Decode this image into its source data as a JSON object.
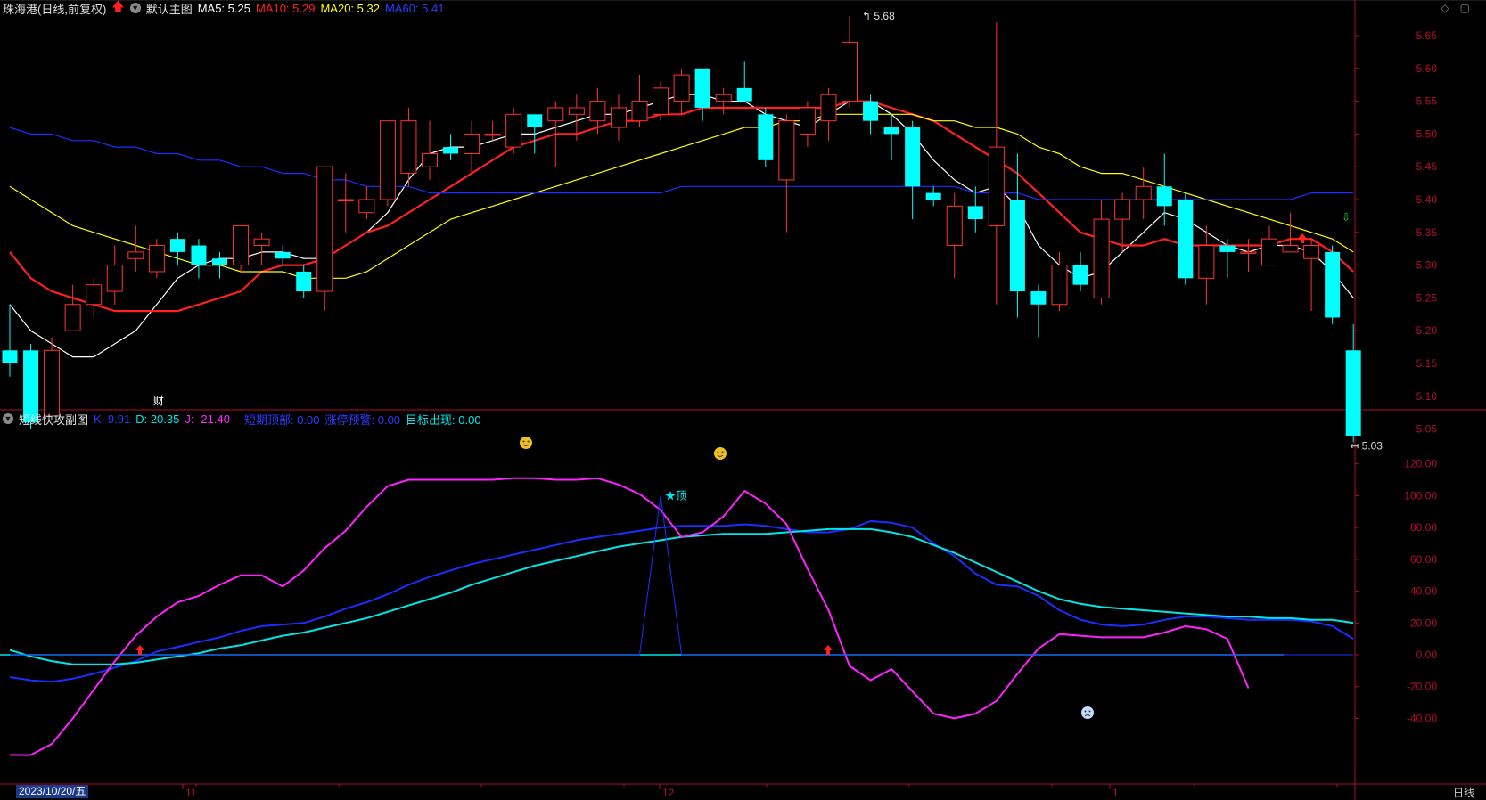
{
  "main_legend": {
    "stock": "珠海港(日线,前复权)",
    "chart_name": "默认主图",
    "ma5": "MA5: 5.25",
    "ma10": "MA10: 5.29",
    "ma20": "MA20: 5.32",
    "ma60": "MA60: 5.41"
  },
  "sub_legend": {
    "name": "短线快攻副图",
    "k": "K: 9.91",
    "d": "D: 20.35",
    "j": "J: -21.40",
    "s1": "短期顶部: 0.00",
    "s2": "涨停预警: 0.00",
    "s3": "目标出现: 0.00"
  },
  "colors": {
    "up": "#ff3232",
    "down": "#00ffff",
    "ma5": "#ffffff",
    "ma10": "#ff2020",
    "ma20": "#ffff00",
    "ma60": "#1a2fff",
    "k": "#1a2fff",
    "d": "#00e6e6",
    "j": "#ff22ff",
    "axis": "#b0102a"
  },
  "annotations": {
    "high": "5.68",
    "low": "5.03",
    "cai": "财",
    "top": "★顶"
  },
  "x_labels": [
    "11",
    "12",
    "1"
  ],
  "date_label": "2023/10/20/五",
  "period_label": "日线",
  "chart_data": [
    {
      "type": "candlestick",
      "y_ticks": [
        "5.65",
        "5.60",
        "5.55",
        "5.50",
        "5.45",
        "5.40",
        "5.35",
        "5.30",
        "5.25",
        "5.20",
        "5.15",
        "5.10",
        "5.05"
      ],
      "ylim": [
        5.0,
        5.71
      ],
      "candles": [
        [
          5.17,
          5.15,
          5.24,
          5.13
        ],
        [
          5.17,
          5.06,
          5.18,
          5.05
        ],
        [
          5.07,
          5.17,
          5.19,
          5.07
        ],
        [
          5.2,
          5.24,
          5.27,
          5.2
        ],
        [
          5.24,
          5.27,
          5.28,
          5.22
        ],
        [
          5.26,
          5.3,
          5.33,
          5.24
        ],
        [
          5.31,
          5.32,
          5.36,
          5.29
        ],
        [
          5.29,
          5.33,
          5.34,
          5.28
        ],
        [
          5.34,
          5.32,
          5.35,
          5.3
        ],
        [
          5.33,
          5.3,
          5.34,
          5.28
        ],
        [
          5.31,
          5.3,
          5.32,
          5.28
        ],
        [
          5.3,
          5.36,
          5.36,
          5.29
        ],
        [
          5.33,
          5.34,
          5.35,
          5.3
        ],
        [
          5.32,
          5.31,
          5.33,
          5.3
        ],
        [
          5.29,
          5.26,
          5.3,
          5.25
        ],
        [
          5.26,
          5.45,
          5.45,
          5.23
        ],
        [
          5.4,
          5.4,
          5.44,
          5.35
        ],
        [
          5.38,
          5.4,
          5.42,
          5.37
        ],
        [
          5.4,
          5.52,
          5.52,
          5.39
        ],
        [
          5.44,
          5.52,
          5.54,
          5.42
        ],
        [
          5.45,
          5.47,
          5.52,
          5.43
        ],
        [
          5.48,
          5.47,
          5.5,
          5.46
        ],
        [
          5.47,
          5.5,
          5.52,
          5.44
        ],
        [
          5.5,
          5.5,
          5.52,
          5.49
        ],
        [
          5.48,
          5.53,
          5.54,
          5.47
        ],
        [
          5.53,
          5.51,
          5.53,
          5.47
        ],
        [
          5.52,
          5.54,
          5.55,
          5.45
        ],
        [
          5.53,
          5.54,
          5.56,
          5.49
        ],
        [
          5.52,
          5.55,
          5.57,
          5.5
        ],
        [
          5.51,
          5.54,
          5.56,
          5.49
        ],
        [
          5.52,
          5.55,
          5.59,
          5.51
        ],
        [
          5.53,
          5.57,
          5.58,
          5.52
        ],
        [
          5.55,
          5.59,
          5.6,
          5.53
        ],
        [
          5.6,
          5.54,
          5.6,
          5.52
        ],
        [
          5.55,
          5.56,
          5.57,
          5.53
        ],
        [
          5.57,
          5.55,
          5.61,
          5.55
        ],
        [
          5.53,
          5.46,
          5.54,
          5.45
        ],
        [
          5.43,
          5.52,
          5.53,
          5.35
        ],
        [
          5.5,
          5.54,
          5.55,
          5.48
        ],
        [
          5.52,
          5.56,
          5.57,
          5.49
        ],
        [
          5.55,
          5.64,
          5.68,
          5.54
        ],
        [
          5.55,
          5.52,
          5.56,
          5.5
        ],
        [
          5.51,
          5.5,
          5.53,
          5.46
        ],
        [
          5.51,
          5.42,
          5.52,
          5.37
        ],
        [
          5.41,
          5.4,
          5.42,
          5.39
        ],
        [
          5.33,
          5.39,
          5.41,
          5.28
        ],
        [
          5.39,
          5.37,
          5.42,
          5.35
        ],
        [
          5.36,
          5.48,
          5.67,
          5.24
        ],
        [
          5.4,
          5.26,
          5.47,
          5.22
        ],
        [
          5.26,
          5.24,
          5.27,
          5.19
        ],
        [
          5.24,
          5.3,
          5.32,
          5.23
        ],
        [
          5.3,
          5.27,
          5.32,
          5.26
        ],
        [
          5.25,
          5.37,
          5.4,
          5.24
        ],
        [
          5.37,
          5.4,
          5.41,
          5.32
        ],
        [
          5.4,
          5.42,
          5.45,
          5.37
        ],
        [
          5.42,
          5.39,
          5.47,
          5.36
        ],
        [
          5.4,
          5.28,
          5.41,
          5.27
        ],
        [
          5.28,
          5.33,
          5.36,
          5.24
        ],
        [
          5.33,
          5.32,
          5.34,
          5.28
        ],
        [
          5.32,
          5.32,
          5.34,
          5.29
        ],
        [
          5.3,
          5.34,
          5.36,
          5.3
        ],
        [
          5.32,
          5.33,
          5.38,
          5.32
        ],
        [
          5.31,
          5.33,
          5.34,
          5.23
        ],
        [
          5.32,
          5.22,
          5.33,
          5.21
        ],
        [
          5.17,
          5.04,
          5.21,
          5.03
        ]
      ],
      "series": [
        {
          "name": "MA5",
          "values": [
            5.24,
            5.2,
            5.18,
            5.16,
            5.16,
            5.18,
            5.2,
            5.24,
            5.28,
            5.3,
            5.31,
            5.31,
            5.32,
            5.32,
            5.31,
            5.31,
            5.33,
            5.35,
            5.38,
            5.43,
            5.47,
            5.48,
            5.48,
            5.49,
            5.5,
            5.5,
            5.51,
            5.52,
            5.53,
            5.53,
            5.54,
            5.55,
            5.56,
            5.56,
            5.55,
            5.55,
            5.53,
            5.52,
            5.51,
            5.53,
            5.55,
            5.55,
            5.53,
            5.5,
            5.46,
            5.43,
            5.41,
            5.42,
            5.39,
            5.33,
            5.3,
            5.28,
            5.29,
            5.32,
            5.35,
            5.38,
            5.37,
            5.35,
            5.33,
            5.32,
            5.33,
            5.33,
            5.32,
            5.29,
            5.25
          ]
        },
        {
          "name": "MA10",
          "values": [
            5.32,
            5.28,
            5.26,
            5.25,
            5.24,
            5.23,
            5.23,
            5.23,
            5.23,
            5.24,
            5.25,
            5.26,
            5.29,
            5.3,
            5.3,
            5.31,
            5.33,
            5.35,
            5.36,
            5.38,
            5.4,
            5.42,
            5.44,
            5.46,
            5.48,
            5.49,
            5.5,
            5.5,
            5.51,
            5.52,
            5.52,
            5.53,
            5.53,
            5.54,
            5.54,
            5.54,
            5.54,
            5.54,
            5.54,
            5.54,
            5.55,
            5.55,
            5.54,
            5.53,
            5.52,
            5.5,
            5.48,
            5.46,
            5.44,
            5.41,
            5.38,
            5.35,
            5.34,
            5.33,
            5.33,
            5.34,
            5.33,
            5.33,
            5.33,
            5.33,
            5.33,
            5.34,
            5.34,
            5.32,
            5.29
          ]
        },
        {
          "name": "MA20",
          "values": [
            5.42,
            5.4,
            5.38,
            5.36,
            5.35,
            5.34,
            5.33,
            5.32,
            5.31,
            5.3,
            5.3,
            5.29,
            5.29,
            5.29,
            5.28,
            5.28,
            5.28,
            5.29,
            5.31,
            5.33,
            5.35,
            5.37,
            5.38,
            5.39,
            5.4,
            5.41,
            5.42,
            5.43,
            5.44,
            5.45,
            5.46,
            5.47,
            5.48,
            5.49,
            5.5,
            5.51,
            5.51,
            5.52,
            5.52,
            5.53,
            5.53,
            5.53,
            5.53,
            5.53,
            5.52,
            5.52,
            5.51,
            5.51,
            5.5,
            5.48,
            5.47,
            5.45,
            5.44,
            5.44,
            5.43,
            5.42,
            5.41,
            5.4,
            5.39,
            5.38,
            5.37,
            5.36,
            5.35,
            5.34,
            5.32
          ]
        },
        {
          "name": "MA60",
          "values": [
            5.51,
            5.5,
            5.5,
            5.49,
            5.49,
            5.48,
            5.48,
            5.47,
            5.47,
            5.46,
            5.46,
            5.45,
            5.45,
            5.44,
            5.44,
            5.43,
            5.43,
            5.42,
            5.42,
            5.42,
            5.41,
            5.41,
            5.41,
            5.41,
            5.41,
            5.41,
            5.41,
            5.41,
            5.41,
            5.41,
            5.41,
            5.41,
            5.42,
            5.42,
            5.42,
            5.42,
            5.42,
            5.42,
            5.42,
            5.42,
            5.42,
            5.42,
            5.42,
            5.42,
            5.42,
            5.42,
            5.41,
            5.41,
            5.41,
            5.4,
            5.4,
            5.4,
            5.4,
            5.4,
            5.4,
            5.4,
            5.4,
            5.4,
            5.4,
            5.4,
            5.4,
            5.4,
            5.41,
            5.41,
            5.41
          ]
        }
      ]
    },
    {
      "type": "line",
      "y_ticks": [
        "120.00",
        "100.00",
        "80.00",
        "60.00",
        "40.00",
        "20.00",
        "0.00",
        "-20.00",
        "-40.00"
      ],
      "ylim": [
        -65,
        128
      ],
      "series": [
        {
          "name": "K",
          "values": [
            -14,
            -16,
            -17,
            -15,
            -12,
            -8,
            -4,
            2,
            5,
            8,
            11,
            15,
            18,
            19,
            20,
            24,
            29,
            33,
            38,
            44,
            49,
            53,
            57,
            60,
            63,
            66,
            69,
            72,
            74,
            76,
            78,
            80,
            81,
            81,
            81,
            82,
            81,
            79,
            77,
            77,
            79,
            84,
            83,
            80,
            70,
            62,
            51,
            44,
            43,
            37,
            28,
            22,
            19,
            18,
            19,
            22,
            24,
            24,
            23,
            22,
            22,
            22,
            21,
            18,
            10
          ]
        },
        {
          "name": "D",
          "values": [
            3,
            -1,
            -4,
            -6,
            -6,
            -6,
            -5,
            -3,
            -1,
            1,
            4,
            6,
            9,
            12,
            14,
            17,
            20,
            23,
            27,
            31,
            35,
            39,
            44,
            48,
            52,
            56,
            59,
            62,
            65,
            68,
            70,
            72,
            74,
            75,
            76,
            76,
            76,
            77,
            78,
            79,
            79,
            79,
            77,
            74,
            69,
            64,
            58,
            52,
            46,
            40,
            35,
            32,
            30,
            29,
            28,
            27,
            26,
            25,
            24,
            24,
            23,
            23,
            22,
            22,
            20
          ]
        },
        {
          "name": "J",
          "values": [
            -63,
            -63,
            -56,
            -40,
            -22,
            -4,
            12,
            24,
            33,
            37,
            44,
            50,
            50,
            43,
            53,
            67,
            78,
            93,
            106,
            110,
            110,
            110,
            110,
            110,
            111,
            111,
            110,
            110,
            111,
            107,
            101,
            91,
            74,
            77,
            87,
            103,
            95,
            82,
            54,
            28,
            -7,
            -16,
            -9,
            -23,
            -37,
            -40,
            -37,
            -29,
            -12,
            4,
            13,
            12,
            11,
            11,
            11,
            14,
            18,
            16,
            10,
            -21
          ]
        },
        {
          "name": "top",
          "values": [
            0,
            0,
            0,
            0,
            0,
            0,
            0,
            0,
            0,
            0,
            0,
            0,
            0,
            0,
            0,
            0,
            0,
            0,
            0,
            0,
            0,
            0,
            0,
            0,
            0,
            0,
            0,
            0,
            0,
            0,
            0,
            100,
            0,
            0,
            0,
            0,
            0,
            0,
            0,
            0,
            0,
            0,
            0,
            0,
            0,
            0,
            0,
            0,
            0,
            0,
            0,
            0,
            0,
            0,
            0,
            0,
            0,
            0,
            0,
            0,
            0,
            0,
            0,
            0,
            0
          ]
        }
      ]
    }
  ]
}
